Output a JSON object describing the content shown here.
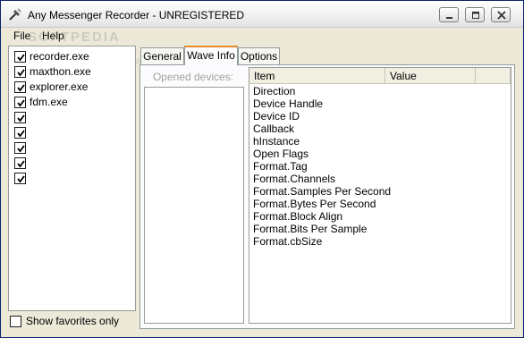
{
  "window": {
    "title": "Any Messenger Recorder - UNREGISTERED",
    "app_icon": "tools-icon",
    "controls": [
      "minimize-icon",
      "maximize-icon",
      "close-icon"
    ]
  },
  "menu": {
    "file": "File",
    "help": "Help"
  },
  "watermark": {
    "text": "SOFTPEDIA",
    "url": "www.softpedia.com"
  },
  "processes": [
    {
      "label": "recorder.exe",
      "checked": true
    },
    {
      "label": "maxthon.exe",
      "checked": true
    },
    {
      "label": "explorer.exe",
      "checked": true
    },
    {
      "label": "fdm.exe",
      "checked": true
    },
    {
      "label": "",
      "checked": true
    },
    {
      "label": "",
      "checked": true
    },
    {
      "label": "",
      "checked": true
    },
    {
      "label": "",
      "checked": true
    },
    {
      "label": "",
      "checked": true
    }
  ],
  "show_favorites": {
    "label": "Show favorites only",
    "checked": false
  },
  "tabs": [
    {
      "label": "General",
      "active": false
    },
    {
      "label": "Wave Info",
      "active": true
    },
    {
      "label": "Options",
      "active": false
    }
  ],
  "devices": {
    "label": "Opened devices:"
  },
  "info_table": {
    "columns": [
      "Item",
      "Value"
    ],
    "rows": [
      "Direction",
      "Device Handle",
      "Device ID",
      "Callback",
      "hInstance",
      "Open Flags",
      "Format.Tag",
      "Format.Channels",
      "Format.Samples Per Second",
      "Format.Bytes Per Second",
      "Format.Block Align",
      "Format.Bits Per Sample",
      "Format.cbSize"
    ]
  }
}
